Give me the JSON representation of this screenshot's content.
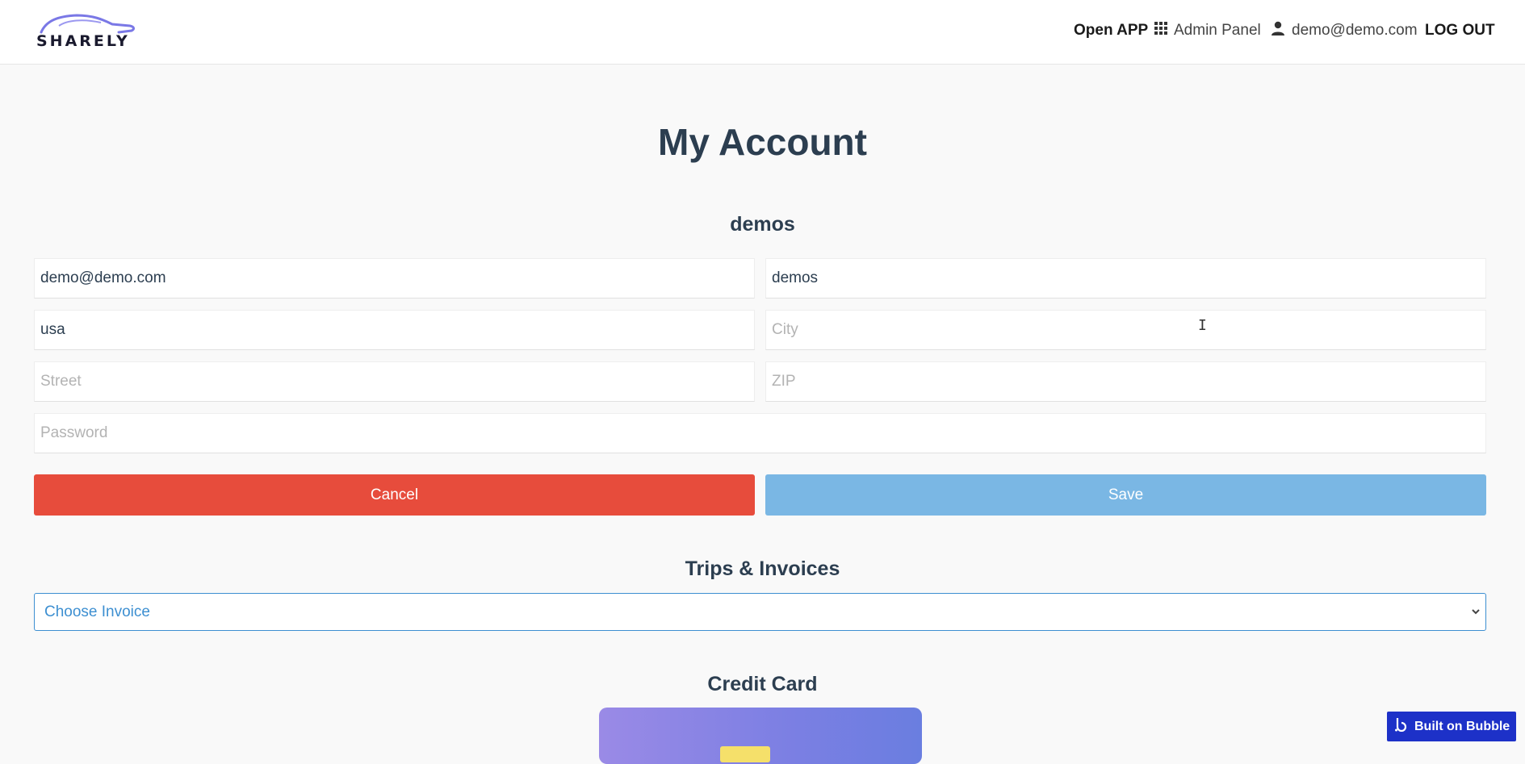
{
  "header": {
    "logo_text": "SHARELY",
    "nav": {
      "open_app": "Open APP",
      "admin_panel": "Admin Panel",
      "user_email": "demo@demo.com",
      "logout": "LOG OUT"
    }
  },
  "main": {
    "title": "My Account",
    "username": "demos",
    "fields": {
      "email": {
        "value": "demo@demo.com",
        "placeholder": ""
      },
      "name": {
        "value": "demos",
        "placeholder": ""
      },
      "country": {
        "value": "usa",
        "placeholder": ""
      },
      "city": {
        "value": "",
        "placeholder": "City"
      },
      "street": {
        "value": "",
        "placeholder": "Street"
      },
      "zip": {
        "value": "",
        "placeholder": "ZIP"
      },
      "password": {
        "value": "",
        "placeholder": "Password"
      }
    },
    "buttons": {
      "cancel": "Cancel",
      "save": "Save"
    },
    "trips_title": "Trips & Invoices",
    "invoice_select": {
      "selected": "Choose Invoice"
    },
    "credit_card_title": "Credit Card"
  },
  "badge": {
    "label": "Built on Bubble"
  },
  "colors": {
    "cancel": "#e74c3c",
    "save": "#7ab7e4",
    "select_border": "#3d8fd1",
    "badge": "#1d31c8"
  },
  "icons": [
    "car-logo-icon",
    "grid-icon",
    "user-icon",
    "chevron-down-icon",
    "bubble-logo-icon"
  ]
}
